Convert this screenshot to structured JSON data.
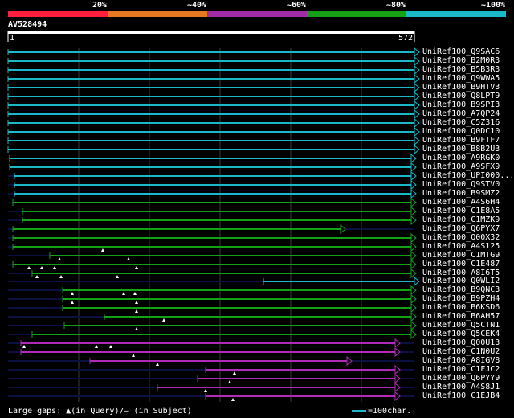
{
  "legend": {
    "percent_labels": [
      "20%",
      "~40%",
      "~60%",
      "~80%",
      "~100%"
    ],
    "band_colors": [
      "#ff1e3c",
      "#e87820",
      "#a02ca6",
      "#16a016",
      "#1ab8c8"
    ]
  },
  "query": {
    "name": "AV528494",
    "start": "1",
    "end": "572"
  },
  "colors": {
    "cyan": "#1ab8c8",
    "green": "#16a016",
    "magenta": "#b02ab8",
    "navy": "#0a1040",
    "grid": "#3a3a3a"
  },
  "hits": [
    {
      "label": "UniRef100_Q9SAC6",
      "color": "cyan"
    },
    {
      "label": "UniRef100_B2M0R3",
      "color": "cyan"
    },
    {
      "label": "UniRef100_B5B3R3",
      "color": "cyan"
    },
    {
      "label": "UniRef100_Q9WWA5",
      "color": "cyan"
    },
    {
      "label": "UniRef100_B9HTV3",
      "color": "cyan"
    },
    {
      "label": "UniRef100_Q8LPT9",
      "color": "cyan"
    },
    {
      "label": "UniRef100_B9SPI3",
      "color": "cyan"
    },
    {
      "label": "UniRef100_A7QP24",
      "color": "cyan"
    },
    {
      "label": "UniRef100_C5Z316",
      "color": "cyan"
    },
    {
      "label": "UniRef100_Q0DC10",
      "color": "cyan"
    },
    {
      "label": "UniRef100_B9FTF7",
      "color": "cyan"
    },
    {
      "label": "UniRef100_B8B2U3",
      "color": "cyan"
    },
    {
      "label": "UniRef100_A9RGK0",
      "color": "cyan"
    },
    {
      "label": "UniRef100_A9SFX9",
      "color": "cyan"
    },
    {
      "label": "UniRef100_UPI000...",
      "color": "cyan"
    },
    {
      "label": "UniRef100_Q9STV0",
      "color": "cyan"
    },
    {
      "label": "UniRef100_B9SMZ2",
      "color": "cyan"
    },
    {
      "label": "UniRef100_A4S6H4",
      "color": "green"
    },
    {
      "label": "UniRef100_C1E8A5",
      "color": "green"
    },
    {
      "label": "UniRef100_C1MZK9",
      "color": "green"
    },
    {
      "label": "UniRef100_Q6PYX7",
      "color": "green"
    },
    {
      "label": "UniRef100_Q00X32",
      "color": "green"
    },
    {
      "label": "UniRef100_A4S125",
      "color": "green"
    },
    {
      "label": "UniRef100_C1MTG9",
      "color": "green"
    },
    {
      "label": "UniRef100_C1E487",
      "color": "green"
    },
    {
      "label": "UniRef100_A8I6T5",
      "color": "green"
    },
    {
      "label": "UniRef100_Q0WLI2",
      "color": "cyan"
    },
    {
      "label": "UniRef100_B9QNC3",
      "color": "green"
    },
    {
      "label": "UniRef100_B9PZH4",
      "color": "green"
    },
    {
      "label": "UniRef100_B6KSD6",
      "color": "green"
    },
    {
      "label": "UniRef100_B6AH57",
      "color": "green"
    },
    {
      "label": "UniRef100_Q5CTN1",
      "color": "green"
    },
    {
      "label": "UniRef100_Q5CEK4",
      "color": "green"
    },
    {
      "label": "UniRef100_Q00U13",
      "color": "magenta"
    },
    {
      "label": "UniRef100_C1N0U2",
      "color": "magenta"
    },
    {
      "label": "UniRef100_A8IGV8",
      "color": "magenta"
    },
    {
      "label": "UniRef100_C1FJC2",
      "color": "magenta"
    },
    {
      "label": "UniRef100_Q6PYY9",
      "color": "magenta"
    },
    {
      "label": "UniRef100_A4S8J1",
      "color": "magenta"
    },
    {
      "label": "UniRef100_C1EJB4",
      "color": "magenta"
    }
  ],
  "footer": {
    "gaps": "Large gaps: ▲(in Query)/– (in Subject)",
    "scale": "=100char."
  }
}
